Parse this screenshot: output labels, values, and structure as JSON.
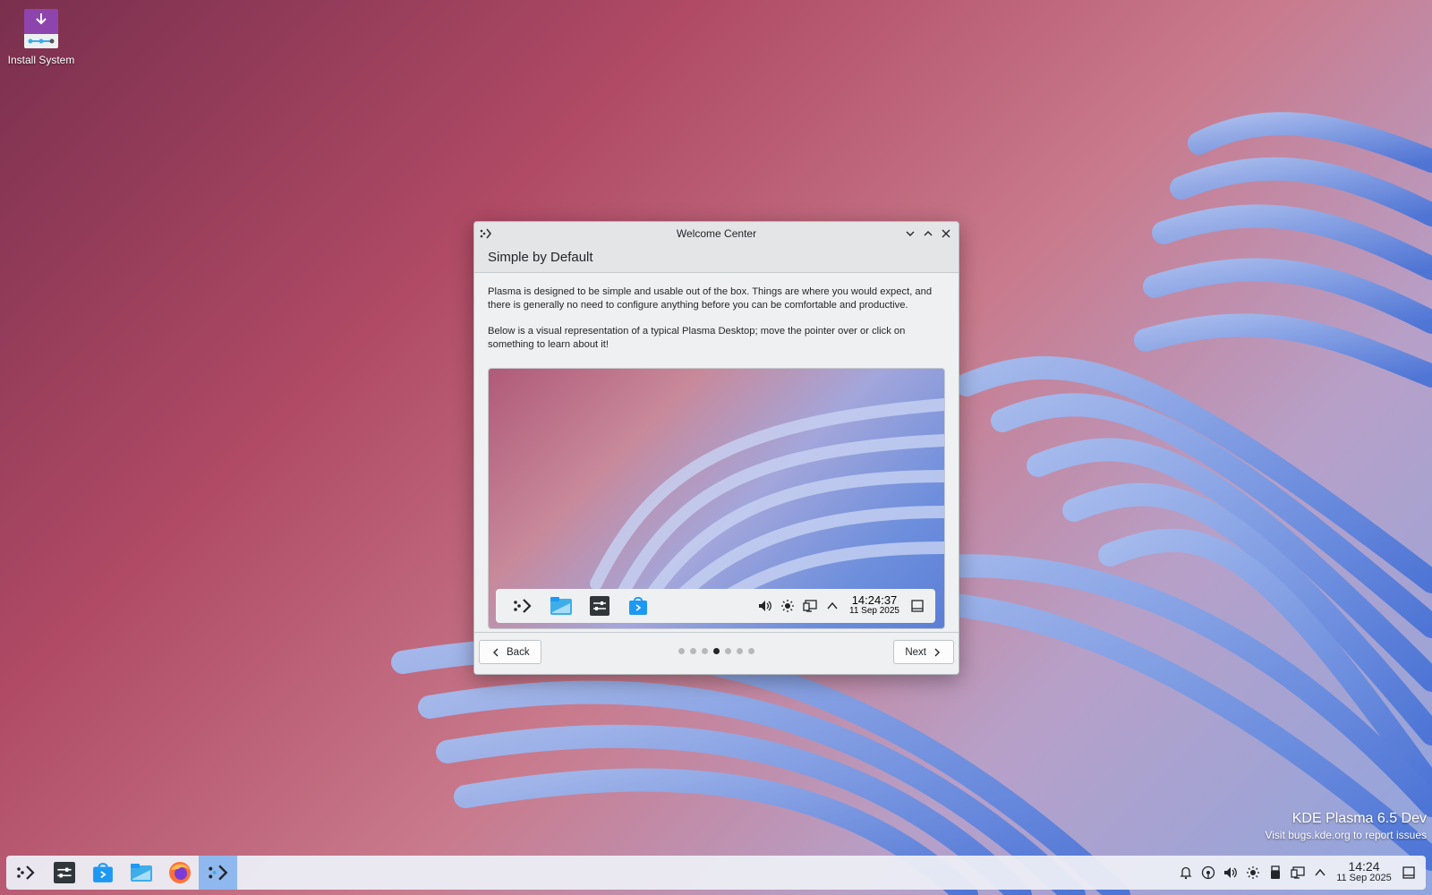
{
  "desktop": {
    "icons": [
      {
        "label": "Install System",
        "icon": "install-system-icon"
      }
    ],
    "watermark": {
      "title": "KDE Plasma 6.5 Dev",
      "subtitle": "Visit bugs.kde.org to report issues"
    }
  },
  "window": {
    "title": "Welcome Center",
    "header": "Simple by Default",
    "paragraph1": "Plasma is designed to be simple and usable out of the box. Things are where you would expect, and there is generally no need to configure anything before you can be comfortable and productive.",
    "paragraph2": "Below is a visual representation of a typical Plasma Desktop; move the pointer over or click on something to learn about it!",
    "preview_panel": {
      "launchers": [
        "kde-launcher-icon",
        "dolphin-icon",
        "system-settings-icon",
        "discover-icon"
      ],
      "tray": [
        "volume-icon",
        "brightness-icon",
        "display-icon",
        "expand-tray-icon"
      ],
      "time": "14:24:37",
      "date": "11 Sep 2025"
    },
    "back_label": "Back",
    "next_label": "Next",
    "pages": {
      "total": 7,
      "current": 4
    }
  },
  "taskbar": {
    "launchers": [
      "kde-launcher-icon",
      "system-settings-icon",
      "discover-icon",
      "dolphin-icon",
      "firefox-icon",
      "welcome-center-icon"
    ],
    "active_index": 5,
    "tray": [
      "notifications-icon",
      "network-icon",
      "volume-icon",
      "brightness-icon",
      "usb-icon",
      "display-icon",
      "expand-tray-icon"
    ],
    "time": "14:24",
    "date": "11 Sep 2025"
  },
  "colors": {
    "accent": "#3daee9",
    "active_task": "#8fb8ee",
    "panel": "#eff0f1"
  }
}
